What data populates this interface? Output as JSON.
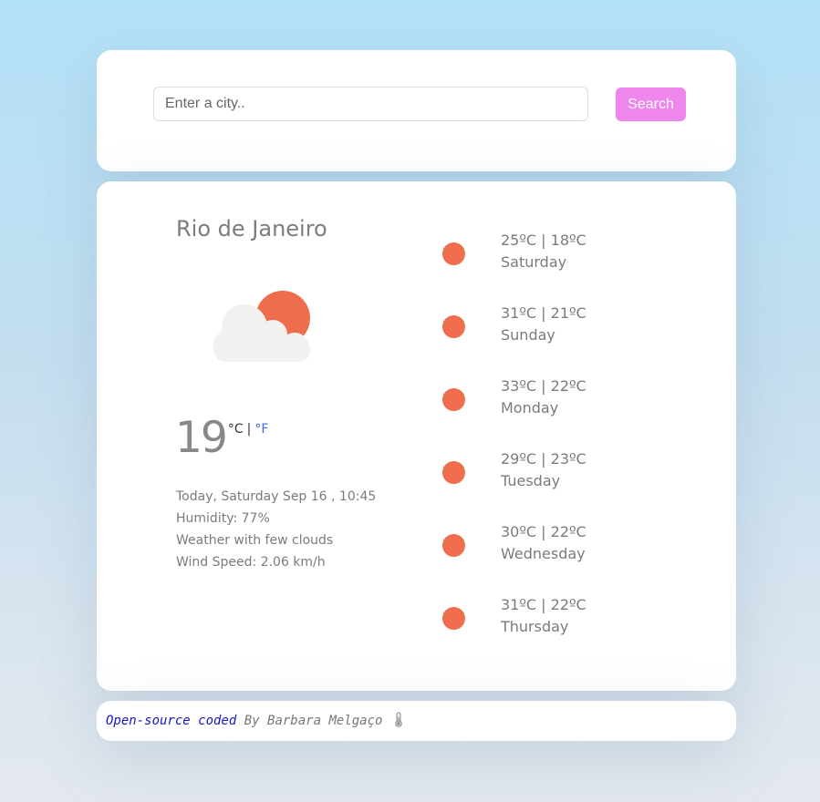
{
  "search": {
    "placeholder": "Enter a city..",
    "value": "",
    "button_label": "Search",
    "button_color": "#ee86ee"
  },
  "current": {
    "city": "Rio de Janeiro",
    "icon": "cloud-with-sun-icon",
    "temperature": "19",
    "unit_c": "°C",
    "unit_separator": "|",
    "unit_f": "°F",
    "date_line": "Today, Saturday Sep 16 , 10:45",
    "humidity_line": "Humidity: 77%",
    "description_line": "Weather with few clouds",
    "wind_line": "Wind Speed: 2.06 km/h"
  },
  "forecast": [
    {
      "temps": "25ºC | 18ºC",
      "day": "Saturday"
    },
    {
      "temps": "31ºC | 21ºC",
      "day": "Sunday"
    },
    {
      "temps": "33ºC | 22ºC",
      "day": "Monday"
    },
    {
      "temps": "29ºC | 23ºC",
      "day": "Tuesday"
    },
    {
      "temps": "30ºC | 22ºC",
      "day": "Wednesday"
    },
    {
      "temps": "31ºC | 22ºC",
      "day": "Thursday"
    }
  ],
  "footer": {
    "link_text": "Open-source coded",
    "author_text": " By Barbara Melgaço",
    "icon": "thermometer-icon"
  },
  "colors": {
    "accent_pink": "#ee86ee",
    "forecast_dot": "#ee6d4d",
    "sun": "#ee6d4d",
    "cloud": "#f1f1ef",
    "fahrenheit_link": "#3c6be0",
    "footer_link": "#1616c8"
  }
}
